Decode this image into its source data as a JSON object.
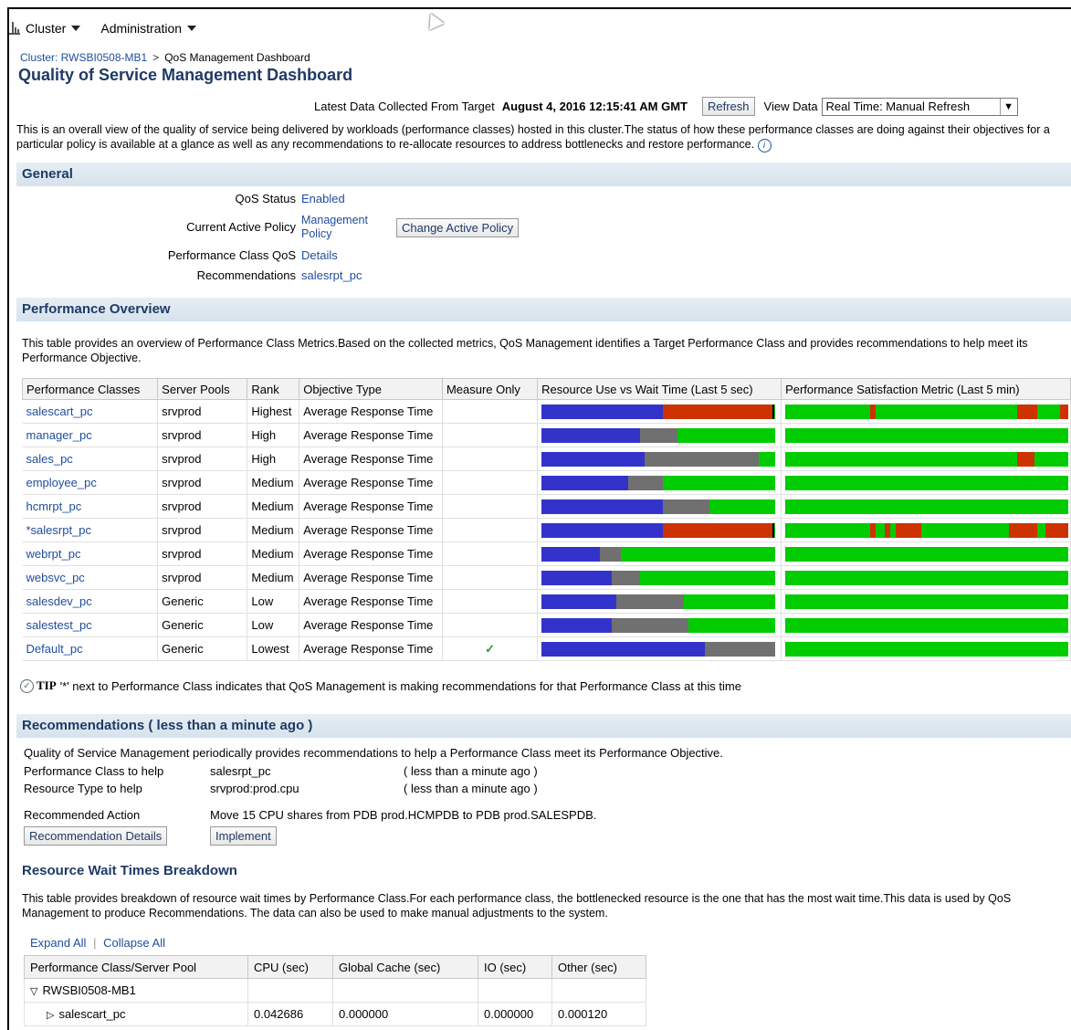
{
  "menu": {
    "cluster_label": "Cluster",
    "admin_label": "Administration"
  },
  "breadcrumb": {
    "parent": "Cluster: RWSBI0508-MB1",
    "separator": ">",
    "current": "QoS Management Dashboard"
  },
  "page_title": "Quality of Service Management Dashboard",
  "topbar": {
    "collected_label": "Latest Data Collected From Target",
    "collected_value": "August 4, 2016 12:15:41 AM GMT",
    "refresh_label": "Refresh",
    "view_data_label": "View Data",
    "view_data_value": "Real Time: Manual Refresh"
  },
  "intro": "This is an overall view of the quality of service being delivered by workloads (performance classes) hosted in this cluster.The status of how these performance classes are doing against their objectives for a particular policy is available at a glance as well as any recommendations to re-allocate resources to address bottlenecks and restore performance.",
  "general": {
    "heading": "General",
    "qos_status_label": "QoS Status",
    "qos_status_value": "Enabled",
    "active_policy_label": "Current Active Policy",
    "active_policy_value_1": "Management",
    "active_policy_value_2": "Policy",
    "change_policy_button": "Change Active Policy",
    "perf_class_label": "Performance Class QoS",
    "perf_class_value": "Details",
    "recommendations_label": "Recommendations",
    "recommendations_value": "salesrpt_pc"
  },
  "perf_overview": {
    "heading": "Performance Overview",
    "desc": "This table provides an overview of Performance Class Metrics.Based on the collected metrics, QoS Management identifies a Target Performance Class and provides recommendations to help meet its Performance Objective.",
    "columns": [
      "Performance Classes",
      "Server Pools",
      "Rank",
      "Objective Type",
      "Measure Only",
      "Resource Use vs Wait Time (Last 5 sec)",
      "Performance Satisfaction Metric (Last 5 min)"
    ],
    "rows": [
      {
        "name": "salescart_pc",
        "pool": "srvprod",
        "rank": "Highest",
        "objective": "Average Response Time",
        "measure": "",
        "use": 0.52,
        "wait_other": 0,
        "wait_bottleneck": 0.47,
        "sat_bad": [
          [
            0.3,
            0.32
          ],
          [
            0.82,
            0.89
          ],
          [
            0.97,
            1.0
          ]
        ]
      },
      {
        "name": "manager_pc",
        "pool": "srvprod",
        "rank": "High",
        "objective": "Average Response Time",
        "measure": "",
        "use": 0.42,
        "wait_other": 0.16,
        "wait_bottleneck": 0,
        "sat_bad": []
      },
      {
        "name": "sales_pc",
        "pool": "srvprod",
        "rank": "High",
        "objective": "Average Response Time",
        "measure": "",
        "use": 0.44,
        "wait_other": 0.49,
        "wait_bottleneck": 0,
        "sat_bad": [
          [
            0.82,
            0.88
          ]
        ]
      },
      {
        "name": "employee_pc",
        "pool": "srvprod",
        "rank": "Medium",
        "objective": "Average Response Time",
        "measure": "",
        "use": 0.37,
        "wait_other": 0.15,
        "wait_bottleneck": 0,
        "sat_bad": []
      },
      {
        "name": "hcmrpt_pc",
        "pool": "srvprod",
        "rank": "Medium",
        "objective": "Average Response Time",
        "measure": "",
        "use": 0.52,
        "wait_other": 0.2,
        "wait_bottleneck": 0,
        "sat_bad": []
      },
      {
        "name": "*salesrpt_pc",
        "pool": "srvprod",
        "rank": "Medium",
        "objective": "Average Response Time",
        "measure": "",
        "use": 0.52,
        "wait_other": 0,
        "wait_bottleneck": 0.47,
        "sat_bad": [
          [
            0.3,
            0.32
          ],
          [
            0.35,
            0.37
          ],
          [
            0.39,
            0.48
          ],
          [
            0.79,
            0.89
          ],
          [
            0.92,
            1.0
          ]
        ]
      },
      {
        "name": "webrpt_pc",
        "pool": "srvprod",
        "rank": "Medium",
        "objective": "Average Response Time",
        "measure": "",
        "use": 0.25,
        "wait_other": 0.09,
        "wait_bottleneck": 0,
        "sat_bad": []
      },
      {
        "name": "websvc_pc",
        "pool": "srvprod",
        "rank": "Medium",
        "objective": "Average Response Time",
        "measure": "",
        "use": 0.3,
        "wait_other": 0.12,
        "wait_bottleneck": 0,
        "sat_bad": []
      },
      {
        "name": "salesdev_pc",
        "pool": "Generic",
        "rank": "Low",
        "objective": "Average Response Time",
        "measure": "",
        "use": 0.32,
        "wait_other": 0.29,
        "wait_bottleneck": 0,
        "sat_bad": []
      },
      {
        "name": "salestest_pc",
        "pool": "Generic",
        "rank": "Low",
        "objective": "Average Response Time",
        "measure": "",
        "use": 0.3,
        "wait_other": 0.33,
        "wait_bottleneck": 0,
        "sat_bad": []
      },
      {
        "name": "Default_pc",
        "pool": "Generic",
        "rank": "Lowest",
        "objective": "Average Response Time",
        "measure": "✓",
        "use": 0.7,
        "wait_other": 0.3,
        "wait_bottleneck": 0,
        "sat_bad": []
      }
    ],
    "colors": {
      "use": "#3333cc",
      "wait_other": "#707070",
      "wait_bottleneck": "#cc3300",
      "good": "#00cc00",
      "bad": "#cc3300"
    }
  },
  "tip": {
    "label": "TIP",
    "text": "'*' next to Performance Class indicates that QoS Management is making recommendations for that Performance Class at this time"
  },
  "recommendations": {
    "heading": "Recommendations ( less than a minute ago )",
    "intro": "Quality of Service Management periodically provides recommendations to help a Performance Class meet its Performance Objective.",
    "pc_label": "Performance Class to help",
    "pc_value": "salesrpt_pc",
    "pc_time": "( less than a minute ago )",
    "rt_label": "Resource Type to help",
    "rt_value": "srvprod:prod.cpu",
    "rt_time": "( less than a minute ago )",
    "action_label": "Recommended Action",
    "action_value": "Move 15 CPU shares from PDB prod.HCMPDB to PDB prod.SALESPDB.",
    "details_button": "Recommendation Details",
    "implement_button": "Implement"
  },
  "wait_times": {
    "heading": "Resource Wait Times Breakdown",
    "desc": "This table provides breakdown of resource wait times by Performance Class.For each performance class, the bottlenecked resource is the one that has the most wait time.This data is used by QoS Management to produce Recommendations. The data can also be used to make manual adjustments to the system.",
    "expand_all": "Expand All",
    "collapse_all": "Collapse All",
    "columns": [
      "Performance Class/Server Pool",
      "CPU (sec)",
      "Global Cache (sec)",
      "IO (sec)",
      "Other (sec)"
    ],
    "group": "RWSBI0508-MB1",
    "rows": [
      {
        "name": "salescart_pc",
        "cpu": "0.042686",
        "gc": "0.000000",
        "io": "0.000000",
        "other": "0.000120"
      }
    ]
  }
}
